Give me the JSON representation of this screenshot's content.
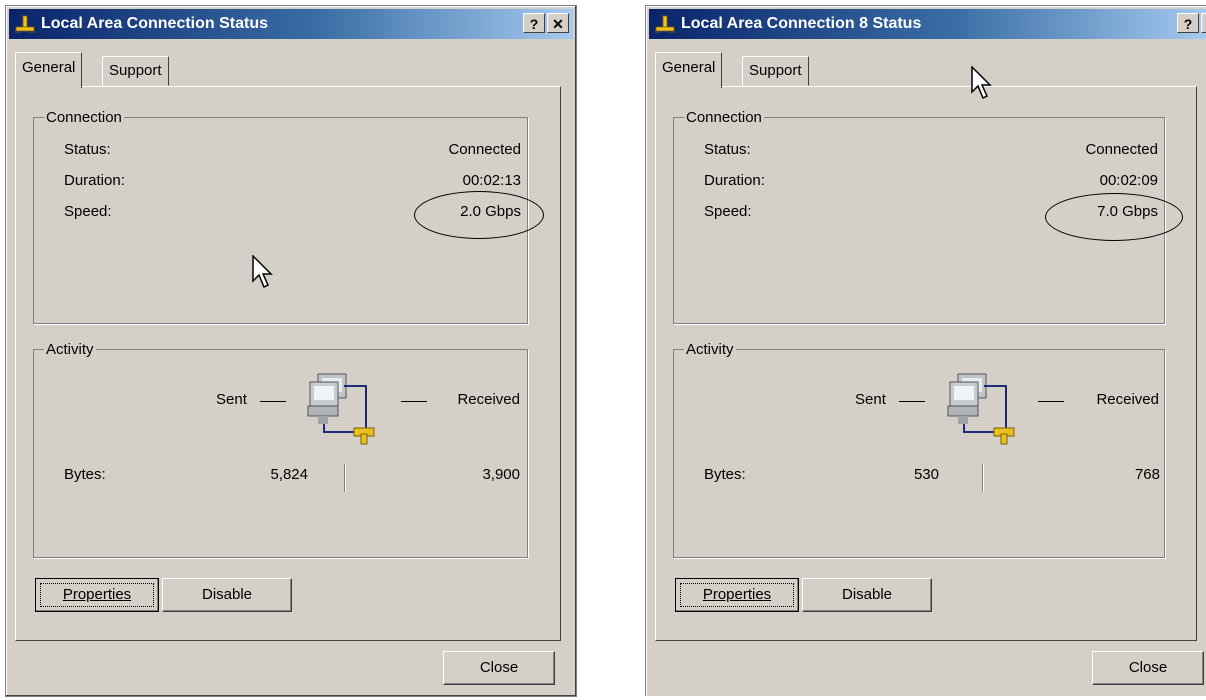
{
  "dialogs": [
    {
      "title": "Local Area Connection Status",
      "help_label": "?",
      "close_x_label": "✕",
      "tabs": [
        "General",
        "Support"
      ],
      "connection": {
        "legend": "Connection",
        "status_label": "Status:",
        "status_value": "Connected",
        "duration_label": "Duration:",
        "duration_value": "00:02:13",
        "speed_label": "Speed:",
        "speed_value": "2.0 Gbps"
      },
      "activity": {
        "legend": "Activity",
        "sent_label": "Sent",
        "received_label": "Received",
        "bytes_label": "Bytes:",
        "bytes_sent": "5,824",
        "bytes_received": "3,900"
      },
      "buttons": {
        "properties": "Properties",
        "disable": "Disable",
        "close": "Close"
      }
    },
    {
      "title": "Local Area Connection 8 Status",
      "help_label": "?",
      "close_x_label": "✕",
      "tabs": [
        "General",
        "Support"
      ],
      "connection": {
        "legend": "Connection",
        "status_label": "Status:",
        "status_value": "Connected",
        "duration_label": "Duration:",
        "duration_value": "00:02:09",
        "speed_label": "Speed:",
        "speed_value": "7.0 Gbps"
      },
      "activity": {
        "legend": "Activity",
        "sent_label": "Sent",
        "received_label": "Received",
        "bytes_label": "Bytes:",
        "bytes_sent": "530",
        "bytes_received": "768"
      },
      "buttons": {
        "properties": "Properties",
        "disable": "Disable",
        "close": "Close"
      }
    }
  ],
  "colors": {
    "dialog_bg": "#d4d0c8",
    "title_start": "#0a246a",
    "title_end": "#a6caf0",
    "title_text": "#ffffff"
  },
  "icons": {
    "title": "network-connection-icon",
    "activity": "network-computers-icon",
    "cursor": "mouse-pointer-icon"
  }
}
